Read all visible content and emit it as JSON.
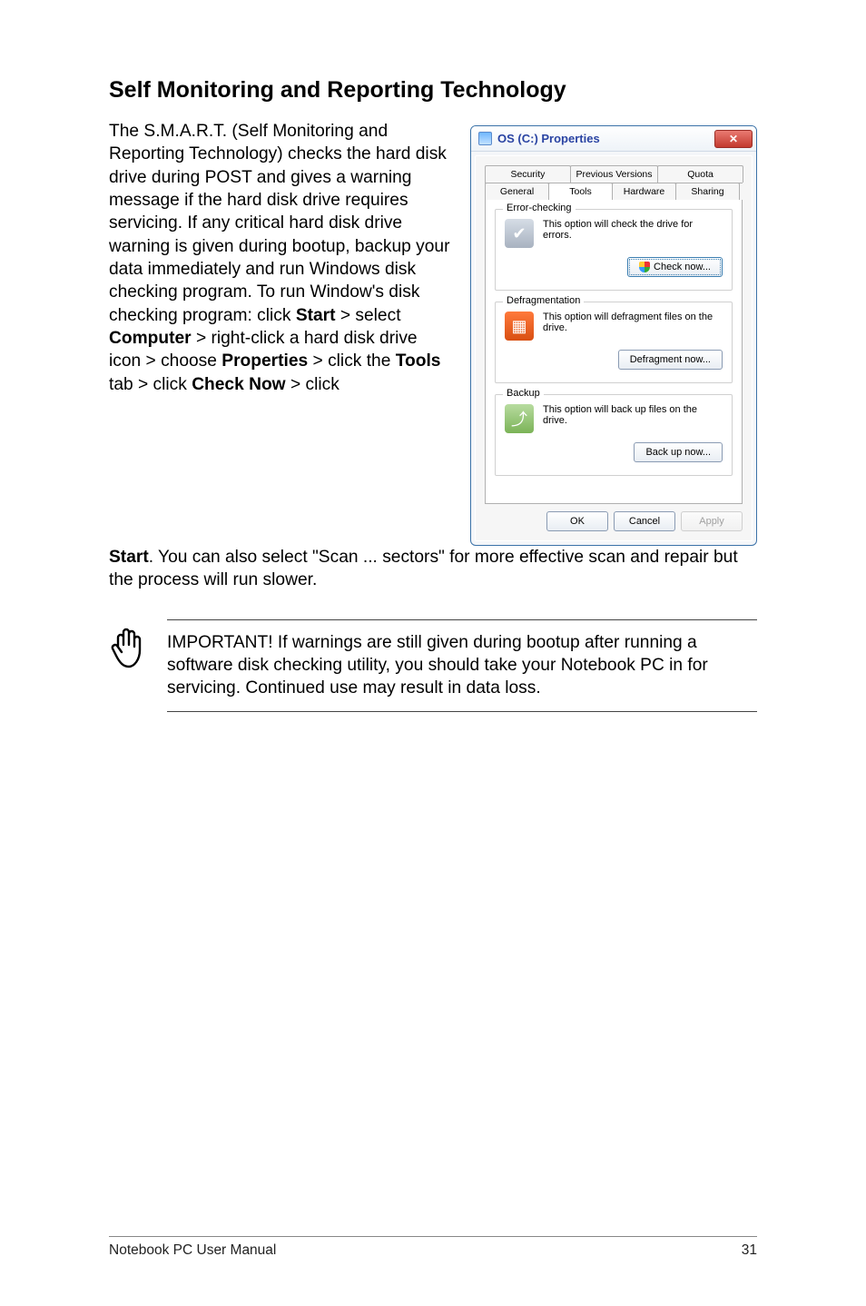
{
  "doc": {
    "heading": "Self Monitoring and Reporting Technology",
    "paragraph": "The S.M.A.R.T. (Self Monitoring and Reporting Technology) checks the hard disk drive during POST and gives a warning message if the hard disk drive requires servicing. If any critical hard disk drive warning is given during bootup, backup your data immediately and run Windows disk checking program. To run Window's disk checking program: click ",
    "start_bold": "Start",
    "gt1": " > select ",
    "computer_bold": "Computer",
    "gt2": " > right-click a hard disk drive icon > choose ",
    "properties_bold": "Properties",
    "gt3": " > click the ",
    "tools_bold": "Tools",
    "gt4": " tab > click ",
    "checknow_bold": "Check Now",
    "gt5": " > click ",
    "start2_bold": "Start",
    "continuation": ". You can also select \"Scan ... sectors\" for more effective scan and repair but the process will run slower.",
    "note": "IMPORTANT! If warnings are still given during bootup after running a software disk checking utility, you should take your Notebook PC in for servicing. Continued use may result in data loss."
  },
  "dialog": {
    "title": "OS (C:) Properties",
    "close_label": "✕",
    "tabs_row1": [
      "Security",
      "Previous Versions",
      "Quota"
    ],
    "tabs_row2": [
      "General",
      "Tools",
      "Hardware",
      "Sharing"
    ],
    "groups": {
      "error": {
        "title": "Error-checking",
        "text": "This option will check the drive for errors.",
        "button": "Check now..."
      },
      "defrag": {
        "title": "Defragmentation",
        "text": "This option will defragment files on the drive.",
        "button": "Defragment now..."
      },
      "backup": {
        "title": "Backup",
        "text": "This option will back up files on the drive.",
        "button": "Back up now..."
      }
    },
    "ok": "OK",
    "cancel": "Cancel",
    "apply": "Apply"
  },
  "footer": {
    "left": "Notebook PC User Manual",
    "right": "31"
  }
}
